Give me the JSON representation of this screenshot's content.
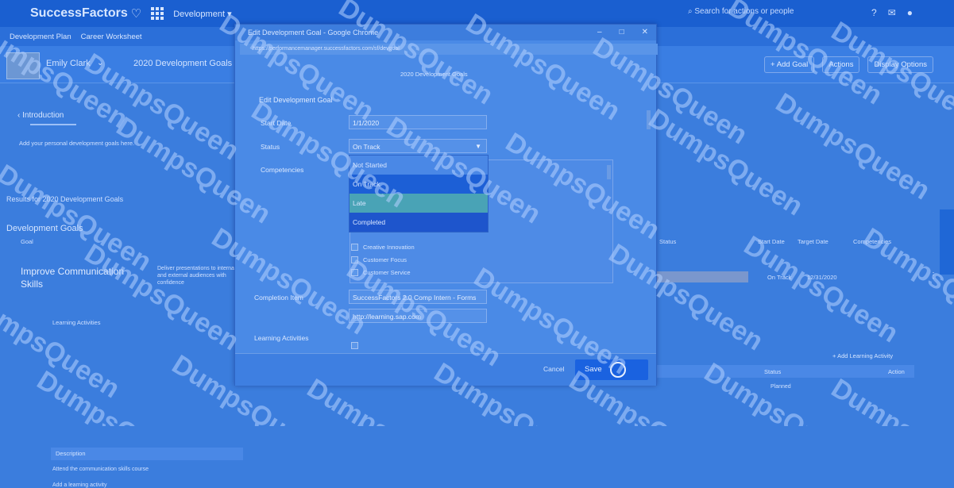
{
  "topbar": {
    "logo": "SuccessFactors",
    "module": "Development",
    "search_placeholder": "Search for actions or people"
  },
  "subbar": {
    "tabs": [
      "Development Plan",
      "Career Worksheet"
    ]
  },
  "header": {
    "user_name": "Emily Clark",
    "doc_title": "2020 Development Goals",
    "buttons": [
      "Add Goal",
      "Actions",
      "Display Options"
    ]
  },
  "left": {
    "intro_tab": "Introduction",
    "intro_text": "Add your personal development goals here.",
    "goals_title": "Results for 2020 Development Goals",
    "section_title": "Development Goals",
    "section_sub": "Goal",
    "goal_name": "Improve Communication Skills",
    "goal_desc": "Deliver presentations to internal and external audiences with confidence",
    "learning_label": "Learning Activities",
    "table_header": "Description",
    "row1": "Attend the communication skills course",
    "row2": "Add a learning activity"
  },
  "right": {
    "columns": [
      "Status",
      "Start Date",
      "Target Date",
      "Competencies"
    ],
    "status_value": "On Track",
    "date_value": "12/31/2020",
    "add_learning": "Add Learning Activity",
    "status_col": "Status",
    "action_col": "Action",
    "pending": "Planned"
  },
  "dialog": {
    "title": "Edit Development Goal - Google Chrome",
    "url": "https://performancemanager.successfactors.com/sf/devgoal",
    "header": "2020 Development Goals",
    "section": "Edit Development Goal",
    "labels": {
      "start_date": "Start Date",
      "status": "Status",
      "competencies": "Competencies",
      "completion": "Completion Item",
      "learning": "Learning Activities"
    },
    "start_date_value": "1/1/2020",
    "status_value": "On Track",
    "status_options": [
      "Not Started",
      "On Track",
      "Late",
      "Completed"
    ],
    "competencies": [
      "Creative Innovation",
      "Customer Focus",
      "Customer Service"
    ],
    "completion_value": "SuccessFactors 2.0 Comp Intern - Forms",
    "completion_url": "http://learning.sap.com",
    "cancel": "Cancel",
    "save": "Save"
  },
  "watermark": "DumpsQueen",
  "colors": {
    "overlay_blue": "#3b7ddd",
    "selected_option": "#1c5fd6",
    "hover_option": "#49a3b6",
    "save_button": "#1a62e0"
  }
}
